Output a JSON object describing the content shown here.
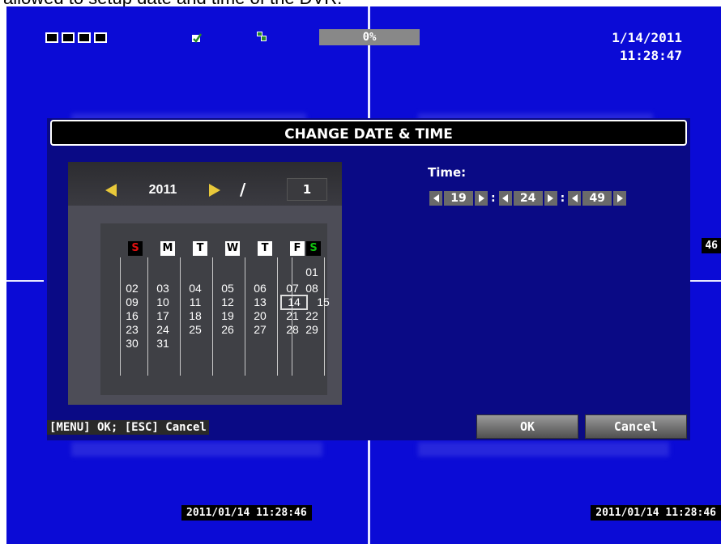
{
  "caption": "allowed to setup date and time of the DVR.",
  "status_bar": {
    "progress": "0%",
    "date": "1/14/2011",
    "time": "11:28:47"
  },
  "side_timestamp": "46",
  "channel_timestamps": [
    "2011/01/14 11:28:46",
    "2011/01/14 11:28:46"
  ],
  "dialog": {
    "title": "CHANGE DATE & TIME",
    "year": "2011",
    "separator": "/",
    "month": "1",
    "weekdays": [
      "S",
      "M",
      "T",
      "W",
      "T",
      "F",
      "S"
    ],
    "days": [
      "01",
      "02",
      "03",
      "04",
      "05",
      "06",
      "07",
      "08",
      "09",
      "10",
      "11",
      "12",
      "13",
      "14",
      "15",
      "16",
      "17",
      "18",
      "19",
      "20",
      "21",
      "22",
      "23",
      "24",
      "25",
      "26",
      "27",
      "28",
      "29",
      "30",
      "31"
    ],
    "selected_day": "14",
    "time_label": "Time:",
    "hour": "19",
    "minute": "24",
    "second": "49",
    "hint": "[MENU] OK; [ESC] Cancel",
    "ok_label": "OK",
    "cancel_label": "Cancel"
  },
  "colors": {
    "background": "#0b0bd6",
    "sunday": "#e01010",
    "saturday": "#10c010",
    "dialog": "#0a0a85"
  }
}
